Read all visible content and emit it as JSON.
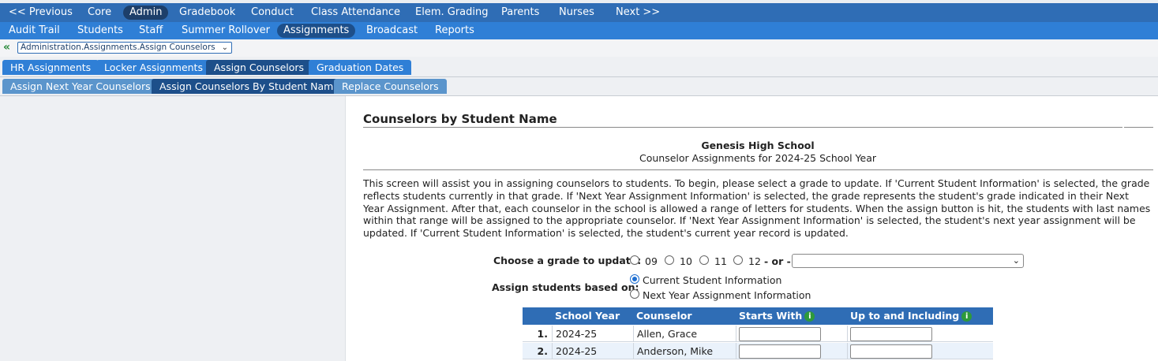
{
  "nav_primary": [
    {
      "label": "<< Previous",
      "active": false
    },
    {
      "label": "Core",
      "active": false
    },
    {
      "label": "Admin",
      "active": true
    },
    {
      "label": "Gradebook",
      "active": false
    },
    {
      "label": "Conduct",
      "active": false
    },
    {
      "label": "Class Attendance",
      "active": false
    },
    {
      "label": "Elem. Grading",
      "active": false
    },
    {
      "label": "Parents",
      "active": false
    },
    {
      "label": "Nurses",
      "active": false
    },
    {
      "label": "Next >>",
      "active": false
    }
  ],
  "nav_secondary": [
    {
      "label": "Audit Trail",
      "active": false
    },
    {
      "label": "Students",
      "active": false
    },
    {
      "label": "Staff",
      "active": false
    },
    {
      "label": "Summer Rollover",
      "active": false
    },
    {
      "label": "Assignments",
      "active": true
    },
    {
      "label": "Broadcast",
      "active": false
    },
    {
      "label": "Reports",
      "active": false
    }
  ],
  "breadcrumb": {
    "value": "Administration.Assignments.Assign Counselors"
  },
  "tabs_level1": [
    {
      "label": "HR Assignments",
      "active": false
    },
    {
      "label": "Locker Assignments",
      "active": false
    },
    {
      "label": "Assign Counselors",
      "active": true
    },
    {
      "label": "Graduation Dates",
      "active": false
    }
  ],
  "tabs_level2": [
    {
      "label": "Assign Next Year Counselors",
      "active": false
    },
    {
      "label": "Assign Counselors By Student Name",
      "active": true
    },
    {
      "label": "Replace Counselors",
      "active": false
    }
  ],
  "main": {
    "heading": "Counselors by Student Name",
    "school_name": "Genesis High School",
    "subtitle": "Counselor Assignments for 2024-25 School Year",
    "description": "This screen will assist you in assigning counselors to students. To begin, please select a grade to update. If 'Current Student Information' is selected, the grade reflects students currently in that grade. If 'Next Year Assignment Information' is selected, the grade represents the student's grade indicated in their Next Year Assignment. After that, each counselor in the school is allowed a range of letters for students. When the assign button is hit, the students with last names within that range will be assigned to the appropriate counselor. If 'Next Year Assignment Information' is selected, the student's next year assignment will be updated. If 'Current Student Information' is selected, the student's current year record is updated.",
    "grade_label": "Choose a grade to update:",
    "grades": [
      "09",
      "10",
      "11",
      "12"
    ],
    "or_text": "- or -",
    "grade_select_value": "",
    "assign_label": "Assign students based on:",
    "assign_options": [
      {
        "label": "Current Student Information",
        "checked": true
      },
      {
        "label": "Next Year Assignment Information",
        "checked": false
      }
    ]
  },
  "table": {
    "headers": {
      "school_year": "School Year",
      "counselor": "Counselor",
      "starts_with": "Starts With",
      "up_to": "Up to and Including"
    },
    "info_icon": "i",
    "rows": [
      {
        "num": "1.",
        "school_year": "2024-25",
        "counselor": "Allen, Grace",
        "starts_with": "",
        "up_to": ""
      },
      {
        "num": "2.",
        "school_year": "2024-25",
        "counselor": "Anderson, Mike",
        "starts_with": "",
        "up_to": ""
      }
    ]
  },
  "icons": {
    "back_arrow": "«",
    "chevron": "⌄"
  }
}
